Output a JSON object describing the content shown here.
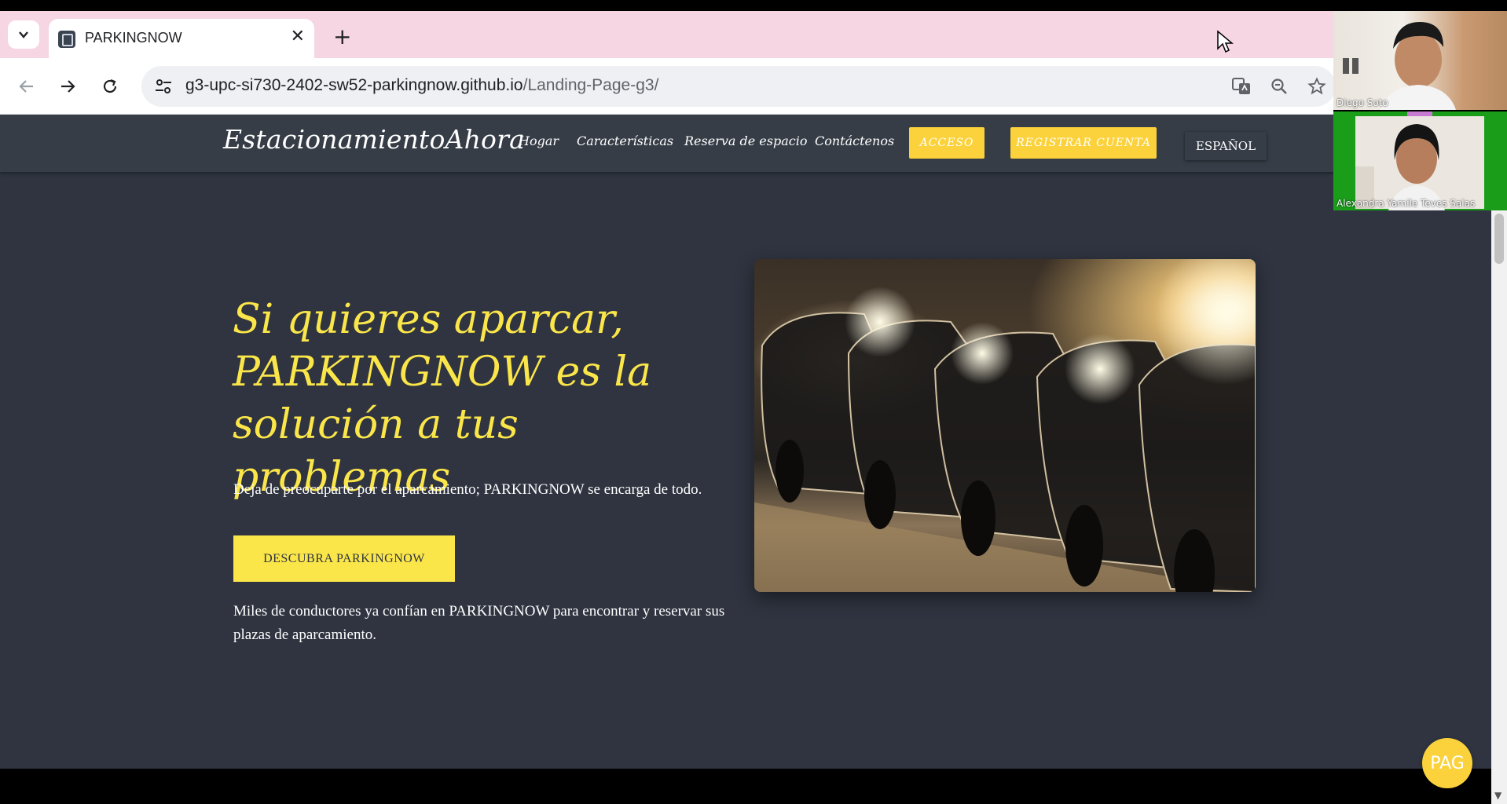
{
  "browser": {
    "tab_title": "PARKINGNOW",
    "tab_close": "✕",
    "new_tab": "+",
    "url_host": "g3-upc-si730-2402-sw52-parkingnow.github.io",
    "url_path": "/Landing-Page-g3/"
  },
  "navbar": {
    "brand": "EstacionamientoAhora",
    "links": [
      "Hogar",
      "Características",
      "Reserva de espacio",
      "Contáctenos"
    ],
    "login": "ACCESO",
    "register": "REGISTRAR CUENTA",
    "language": "ESPAÑOL"
  },
  "hero": {
    "title_line1": "Si quieres aparcar,",
    "title_line2": "PARKINGNOW es la",
    "title_line3": "solución a tus problemas",
    "subtitle": "Deja de preocuparte por el aparcamiento; PARKINGNOW se encarga de todo.",
    "cta": "DESCUBRA PARKINGNOW",
    "footer": "Miles de conductores ya confían en PARKINGNOW para encontrar y reservar sus plazas de aparcamiento."
  },
  "participants": [
    {
      "name": "Diego Soto"
    },
    {
      "name": "Alexandra Yamile Teves Salas"
    }
  ],
  "fab_label": "PAG",
  "colors": {
    "accent": "#fbe64a",
    "button": "#fbd23b",
    "page_bg": "#2f3440",
    "navbar_bg": "#363d47"
  }
}
